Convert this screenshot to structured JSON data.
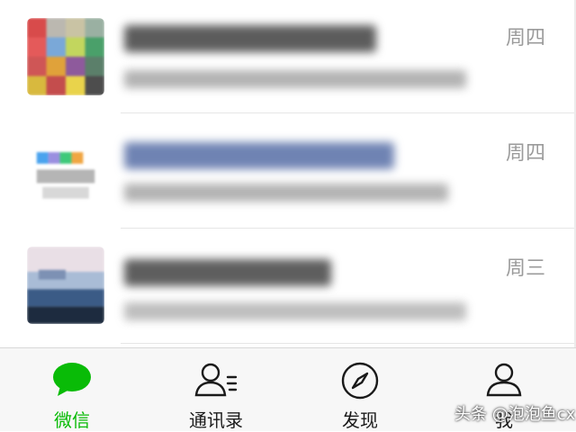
{
  "chat_list": {
    "items": [
      {
        "time": "周四"
      },
      {
        "time": "周四"
      },
      {
        "time": "周三"
      }
    ]
  },
  "tab_bar": {
    "tabs": [
      {
        "label": "微信",
        "icon": "chat-bubble-icon",
        "active": true
      },
      {
        "label": "通讯录",
        "icon": "contacts-icon",
        "active": false
      },
      {
        "label": "发现",
        "icon": "compass-icon",
        "active": false
      },
      {
        "label": "我",
        "icon": "person-icon",
        "active": false
      }
    ]
  },
  "watermark": "头条 @泡泡鱼cx",
  "colors": {
    "accent": "#09bb07",
    "time_text": "#9b9b9b",
    "tabbar_bg": "#f7f7f7"
  }
}
